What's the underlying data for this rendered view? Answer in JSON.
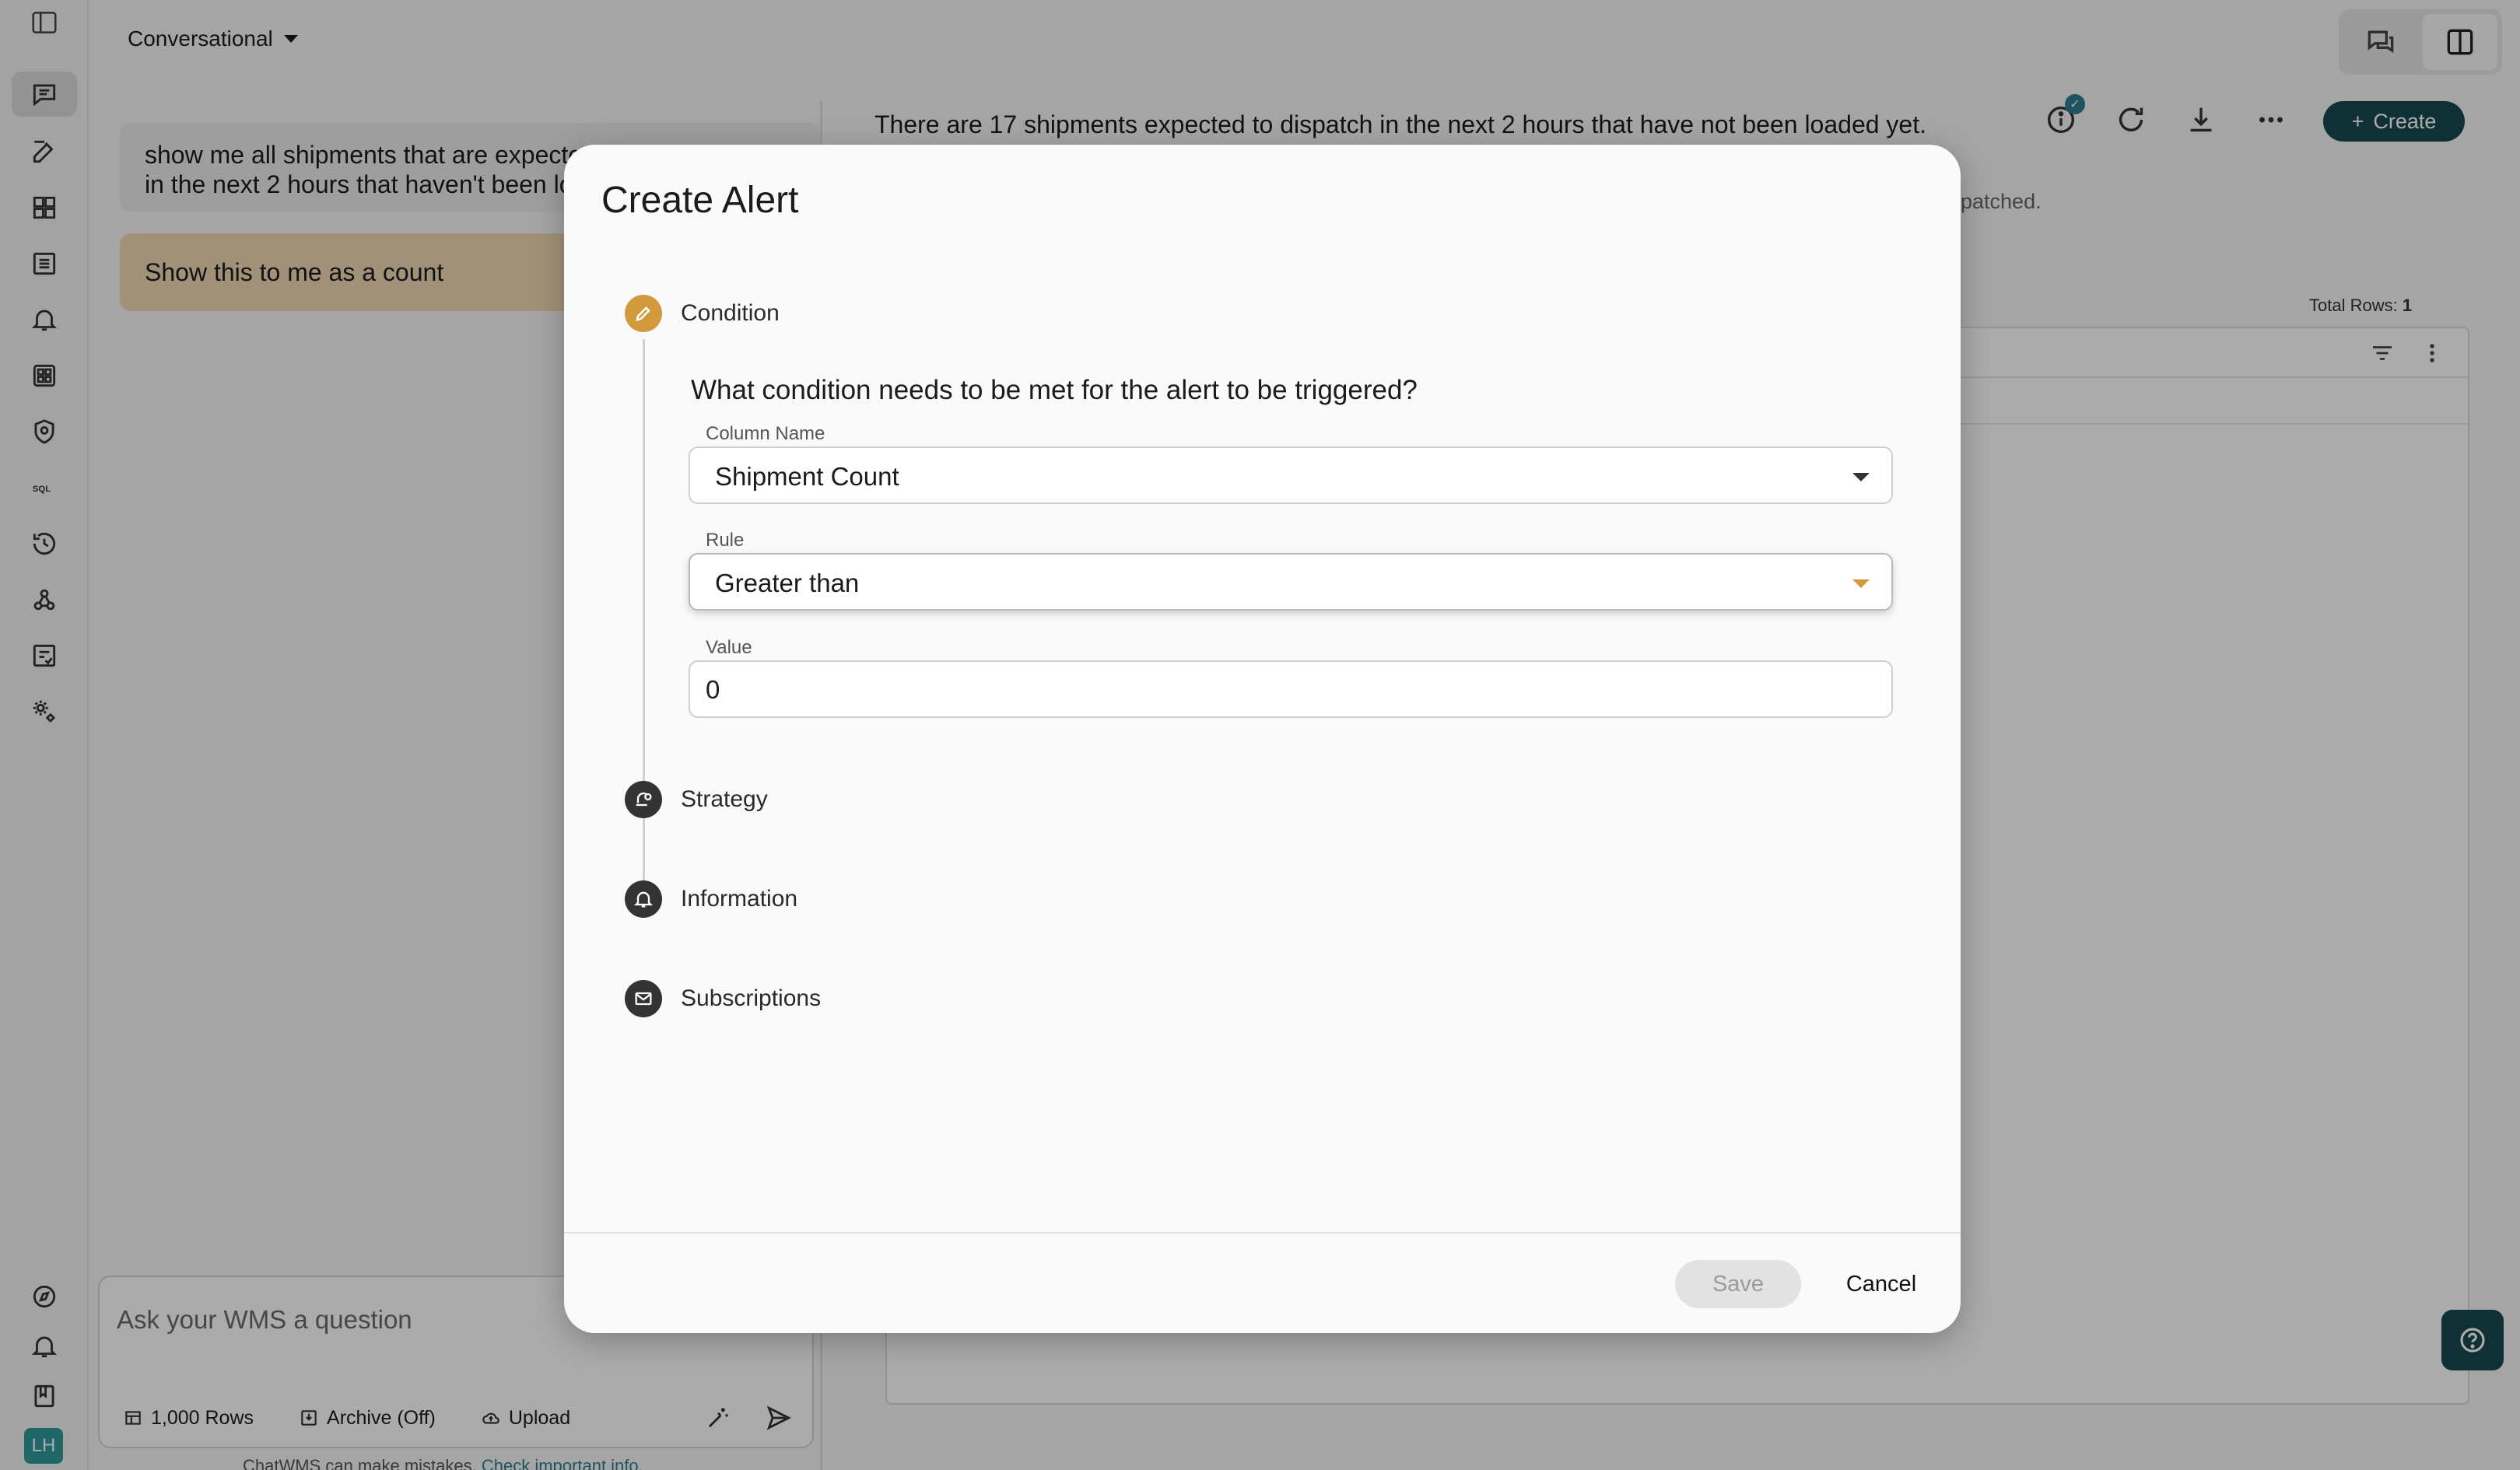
{
  "header": {
    "mode_label": "Conversational"
  },
  "chat": {
    "user_message_line1": "show me all shipments that are expected to dispatch",
    "user_message_line2": "in the next 2 hours that haven't been loaded yet",
    "followup_message": "Show this to me as a count",
    "input_placeholder": "Ask your WMS a question",
    "rows_label": "1,000 Rows",
    "archive_label": "Archive (Off)",
    "upload_label": "Upload",
    "disclaimer_text": "ChatWMS can make mistakes.",
    "disclaimer_link": "Check important info."
  },
  "result": {
    "summary": "There are 17 shipments expected to dispatch in the next 2 hours that have not been loaded yet.",
    "subtext": "patched.",
    "total_rows_label": "Total Rows:",
    "total_rows_value": "1",
    "create_label": "Create"
  },
  "user": {
    "initials": "LH"
  },
  "modal": {
    "title": "Create Alert",
    "steps": [
      {
        "label": "Condition"
      },
      {
        "label": "Strategy"
      },
      {
        "label": "Information"
      },
      {
        "label": "Subscriptions"
      }
    ],
    "question": "What condition needs to be met for the alert to be triggered?",
    "column_name_label": "Column Name",
    "column_name_value": "Shipment Count",
    "rule_label": "Rule",
    "rule_value": "Greater than",
    "value_label": "Value",
    "value_value": "0",
    "save_label": "Save",
    "cancel_label": "Cancel"
  },
  "colors": {
    "accent": "#d29a3c",
    "brand": "#17494f",
    "overlay": "rgba(0,0,0,0.33)"
  }
}
